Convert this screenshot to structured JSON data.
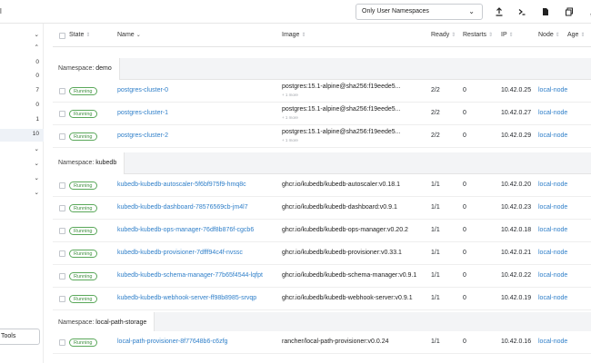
{
  "topbar": {
    "crumb": "l",
    "namespace_filter": "Only User Namespaces",
    "icons": [
      "upload-icon",
      "terminal-icon",
      "file-icon",
      "copy-icon"
    ]
  },
  "sidebar": {
    "rows": [
      {
        "value": "⌄"
      },
      {
        "value": "⌃"
      },
      {
        "value": "0"
      },
      {
        "value": "0"
      },
      {
        "value": "7"
      },
      {
        "value": "0"
      },
      {
        "value": "1"
      },
      {
        "value": "10"
      },
      {
        "value": "⌄"
      },
      {
        "value": "⌄"
      },
      {
        "value": "⌄"
      },
      {
        "value": "⌄"
      },
      {
        "value": "⌄"
      }
    ],
    "tools_label": "Tools"
  },
  "table": {
    "headers": {
      "state": "State",
      "name": "Name",
      "image": "Image",
      "ready": "Ready",
      "restarts": "Restarts",
      "ip": "IP",
      "node": "Node",
      "age": "Age"
    },
    "groups": [
      {
        "prefix": "Namespace:",
        "namespace": "demo",
        "rows": [
          {
            "state": "Running",
            "name": "postgres-cluster-0",
            "image": "postgres:15.1-alpine@sha256:f19eede5...",
            "image_sub": "+ 1 more",
            "ready": "2/2",
            "restarts": "0",
            "ip": "10.42.0.25",
            "node": "local-node"
          },
          {
            "state": "Running",
            "name": "postgres-cluster-1",
            "image": "postgres:15.1-alpine@sha256:f19eede5...",
            "image_sub": "+ 1 more",
            "ready": "2/2",
            "restarts": "0",
            "ip": "10.42.0.27",
            "node": "local-node"
          },
          {
            "state": "Running",
            "name": "postgres-cluster-2",
            "image": "postgres:15.1-alpine@sha256:f19eede5...",
            "image_sub": "+ 1 more",
            "ready": "2/2",
            "restarts": "0",
            "ip": "10.42.0.29",
            "node": "local-node"
          }
        ]
      },
      {
        "prefix": "Namespace:",
        "namespace": "kubedb",
        "rows": [
          {
            "state": "Running",
            "name": "kubedb-kubedb-autoscaler-5f6bf975f9-hmq8c",
            "image": "ghcr.io/kubedb/kubedb-autoscaler:v0.18.1",
            "ready": "1/1",
            "restarts": "0",
            "ip": "10.42.0.20",
            "node": "local-node"
          },
          {
            "state": "Running",
            "name": "kubedb-kubedb-dashboard-78576569cb-jm4l7",
            "image": "ghcr.io/kubedb/kubedb-dashboard:v0.9.1",
            "ready": "1/1",
            "restarts": "0",
            "ip": "10.42.0.23",
            "node": "local-node"
          },
          {
            "state": "Running",
            "name": "kubedb-kubedb-ops-manager-76df8b876f-cgcb6",
            "image": "ghcr.io/kubedb/kubedb-ops-manager:v0.20.2",
            "ready": "1/1",
            "restarts": "0",
            "ip": "10.42.0.18",
            "node": "local-node"
          },
          {
            "state": "Running",
            "name": "kubedb-kubedb-provisioner-7dfff94c4f-nvssc",
            "image": "ghcr.io/kubedb/kubedb-provisioner:v0.33.1",
            "ready": "1/1",
            "restarts": "0",
            "ip": "10.42.0.21",
            "node": "local-node"
          },
          {
            "state": "Running",
            "name": "kubedb-kubedb-schema-manager-77b65f4544-lqfpt",
            "image": "ghcr.io/kubedb/kubedb-schema-manager:v0.9.1",
            "ready": "1/1",
            "restarts": "0",
            "ip": "10.42.0.22",
            "node": "local-node"
          },
          {
            "state": "Running",
            "name": "kubedb-kubedb-webhook-server-ff98b8985-srvqp",
            "image": "ghcr.io/kubedb/kubedb-webhook-server:v0.9.1",
            "ready": "1/1",
            "restarts": "0",
            "ip": "10.42.0.19",
            "node": "local-node"
          }
        ]
      },
      {
        "prefix": "Namespace:",
        "namespace": "local-path-storage",
        "rows": [
          {
            "state": "Running",
            "name": "local-path-provisioner-8f77648b6-c6zfg",
            "image": "rancher/local-path-provisioner:v0.0.24",
            "ready": "1/1",
            "restarts": "0",
            "ip": "10.42.0.16",
            "node": "local-node"
          }
        ]
      }
    ]
  }
}
